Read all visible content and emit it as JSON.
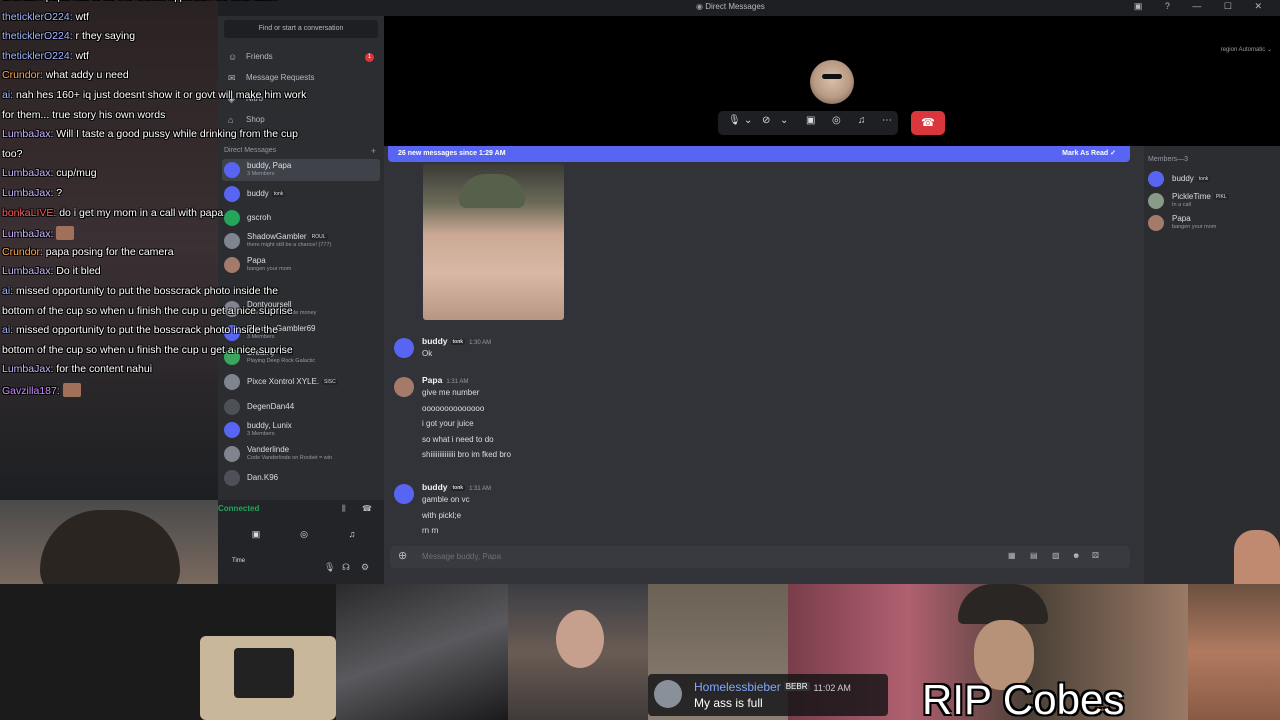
{
  "window": {
    "title": "Direct Messages",
    "controls": "▣ ? — ☐ ✕"
  },
  "sidebar": {
    "find": "Find or start a conversation",
    "nav": [
      {
        "icon": "friends-icon",
        "glyph": "☺",
        "label": "Friends",
        "badge": "1"
      },
      {
        "icon": "message-requests-icon",
        "glyph": "✉",
        "label": "Message Requests",
        "badge": ""
      },
      {
        "icon": "nitro-icon",
        "glyph": "◈",
        "label": "Nitro",
        "badge": ""
      },
      {
        "icon": "shop-icon",
        "glyph": "⌂",
        "label": "Shop",
        "badge": ""
      }
    ],
    "dm_header": "Direct Messages",
    "dms": [
      {
        "name": "buddy, Papa",
        "sub": "3 Members",
        "tag": "",
        "color": "#5865f2",
        "active": true
      },
      {
        "name": "buddy",
        "sub": "",
        "tag": "tonk",
        "color": "#5865f2",
        "active": false
      },
      {
        "name": "gscroh",
        "sub": "",
        "tag": "",
        "color": "#23a55a",
        "active": false
      },
      {
        "name": "ShadowGambler",
        "sub": "there might still be a chance! (777)",
        "tag": "ROUL",
        "color": "#80848e",
        "active": false
      },
      {
        "name": "Papa",
        "sub": "bangen your mom",
        "tag": "",
        "color": "#a47a6a",
        "active": false
      },
      {
        "name": "Dontyoursell",
        "sub": "ey sold but still made money",
        "tag": "",
        "color": "#80848e",
        "active": false
      },
      {
        "name": "ShadowGambler69",
        "sub": "3 Members",
        "tag": "",
        "color": "#5865f2",
        "active": false
      },
      {
        "name": "Dreamy",
        "sub": "Playing Deep Rock Galactic",
        "tag": "PIKL",
        "color": "#3ba55d",
        "active": false
      },
      {
        "name": "Pixce Xontrol XYLE.",
        "sub": "",
        "tag": "SISC",
        "color": "#80848e",
        "active": false
      },
      {
        "name": "DegenDan44",
        "sub": "",
        "tag": "",
        "color": "#4e5058",
        "active": false
      },
      {
        "name": "buddy, Lunix",
        "sub": "3 Members",
        "tag": "",
        "color": "#5865f2",
        "active": false
      },
      {
        "name": "Vanderlinde",
        "sub": "Code Vanderlinde on Roobet = win",
        "tag": "",
        "color": "#80848e",
        "active": false
      },
      {
        "name": "Dan.K96",
        "sub": "",
        "tag": "",
        "color": "#4e5058",
        "active": false
      }
    ],
    "voice": {
      "status": "Connected"
    },
    "user": {
      "name": "Time"
    }
  },
  "call": {
    "region": "region   Automatic  ⌄",
    "controls": [
      {
        "name": "mic-icon",
        "glyph": "🎙"
      },
      {
        "name": "mic-options-chevron-icon",
        "glyph": "⌄"
      },
      {
        "name": "camera-off-icon",
        "glyph": "⊘"
      },
      {
        "name": "camera-options-chevron-icon",
        "glyph": "⌄"
      },
      {
        "name": "screenshare-icon",
        "glyph": "▣"
      },
      {
        "name": "activity-icon",
        "glyph": "◎"
      },
      {
        "name": "soundboard-icon",
        "glyph": "♫"
      },
      {
        "name": "more-icon",
        "glyph": "⋯"
      }
    ],
    "hangup_glyph": "☎"
  },
  "chat": {
    "new_banner": "26 new messages since 1:29 AM",
    "mark_read": "Mark As Read",
    "messages": [
      {
        "author": "buddy",
        "tag": "tonk",
        "time": "1:30 AM",
        "color": "#5865f2",
        "lines": [
          "Ok"
        ]
      },
      {
        "author": "Papa",
        "tag": "",
        "time": "1:31 AM",
        "color": "#a47a6a",
        "lines": [
          "give me number",
          "oooooooooooooo",
          "i got your juice",
          "so what i need to do",
          "shiiiiiiiiiiiiii bro im fked bro"
        ]
      },
      {
        "author": "buddy",
        "tag": "tonk",
        "time": "1:31 AM",
        "color": "#5865f2",
        "lines": [
          "gamble on vc",
          "with pickl;e",
          "rn rn"
        ]
      }
    ],
    "composer_placeholder": "Message buddy, Papa"
  },
  "members": {
    "header": "Members—3",
    "list": [
      {
        "name": "buddy",
        "tag": "tonk",
        "sub": "",
        "color": "#5865f2"
      },
      {
        "name": "PickleTime",
        "tag": "PIKL",
        "sub": "In a call",
        "color": "#8a9a88"
      },
      {
        "name": "Papa",
        "tag": "",
        "sub": "bangen your mom",
        "color": "#a47a6a"
      }
    ]
  },
  "stream_chat": [
    {
      "user": "Crundor:",
      "color": "#ffa64d",
      "text": " papa has to be the lowest iq person ive ever seen",
      "emote": false
    },
    {
      "user": "theticklerO224:",
      "color": "#9fb6ff",
      "text": " wtf",
      "emote": false
    },
    {
      "user": "theticklerO224:",
      "color": "#9fb6ff",
      "text": " r they saying",
      "emote": false
    },
    {
      "user": "theticklerO224:",
      "color": "#9fb6ff",
      "text": " wtf",
      "emote": false
    },
    {
      "user": "Crundor:",
      "color": "#ffa64d",
      "text": " what addy u need",
      "emote": false
    },
    {
      "user": "ai:",
      "color": "#9fb6ff",
      "text": " nah hes 160+ iq just doesnt show it or govt will make him work",
      "emote": false
    },
    {
      "user": "",
      "color": "#ffffff",
      "text": "for them... true story his own words",
      "emote": false
    },
    {
      "user": "LumbaJax:",
      "color": "#c9b6ff",
      "text": " Will I taste a good pussy while drinking from the cup",
      "emote": false
    },
    {
      "user": "",
      "color": "#ffffff",
      "text": "too?",
      "emote": false
    },
    {
      "user": "LumbaJax:",
      "color": "#c9b6ff",
      "text": " cup/mug",
      "emote": false
    },
    {
      "user": "LumbaJax:",
      "color": "#c9b6ff",
      "text": " ?",
      "emote": false
    },
    {
      "user": "bonkaLIVE:",
      "color": "#ff5a5a",
      "text": " do i get my mom in a call with papa",
      "emote": false
    },
    {
      "user": "LumbaJax:",
      "color": "#c9b6ff",
      "text": " ",
      "emote": true
    },
    {
      "user": "Crundor:",
      "color": "#ffa64d",
      "text": " papa posing for the camera",
      "emote": false
    },
    {
      "user": "LumbaJax:",
      "color": "#c9b6ff",
      "text": " Do it bled",
      "emote": false
    },
    {
      "user": "ai:",
      "color": "#9fb6ff",
      "text": " missed opportunity to put the bosscrack photo inside the",
      "emote": false
    },
    {
      "user": "",
      "color": "#ffffff",
      "text": "bottom of the cup so when u finish the cup u get a nice suprise",
      "emote": false
    },
    {
      "user": "ai:",
      "color": "#9fb6ff",
      "text": " missed opportunity to put the bosscrack photo inside the",
      "emote": false
    },
    {
      "user": "",
      "color": "#ffffff",
      "text": "bottom of the cup so when u finish the cup u get a nice suprise",
      "emote": false
    },
    {
      "user": "LumbaJax:",
      "color": "#c9b6ff",
      "text": " for the content nahui",
      "emote": false
    },
    {
      "user": "Gavzilla187:",
      "color": "#c98bff",
      "text": " ",
      "emote": true
    }
  ],
  "notification": {
    "name": "Homelessbieber",
    "tag": "BEBR",
    "time": "11:02 AM",
    "text": "My ass is full"
  },
  "overlay_caption": "RIP Cobes"
}
